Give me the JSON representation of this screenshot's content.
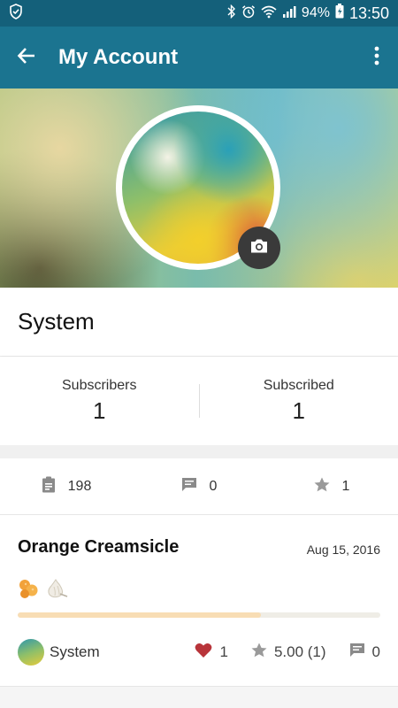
{
  "status_bar": {
    "battery": "94%",
    "time": "13:50"
  },
  "app_bar": {
    "title": "My Account"
  },
  "profile": {
    "name": "System",
    "subscribers_label": "Subscribers",
    "subscribers_count": "1",
    "subscribed_label": "Subscribed",
    "subscribed_count": "1"
  },
  "stats": {
    "posts": "198",
    "comments": "0",
    "favorites": "1"
  },
  "post": {
    "title": "Orange Creamsicle",
    "date": "Aug 15, 2016",
    "progress_fraction": 0.67,
    "author": "System",
    "likes": "1",
    "rating": "5.00 (1)",
    "comments": "0"
  },
  "colors": {
    "status_bar": "#14607a",
    "app_bar": "#1b7490",
    "heart": "#b8343a",
    "progress_fill": "#f8ddb4"
  },
  "icons": [
    "shield-icon",
    "bluetooth-icon",
    "alarm-icon",
    "wifi-icon",
    "signal-icon",
    "battery-icon",
    "back-arrow-icon",
    "more-vert-icon",
    "camera-icon",
    "clipboard-icon",
    "comment-icon",
    "star-icon",
    "heart-icon"
  ]
}
